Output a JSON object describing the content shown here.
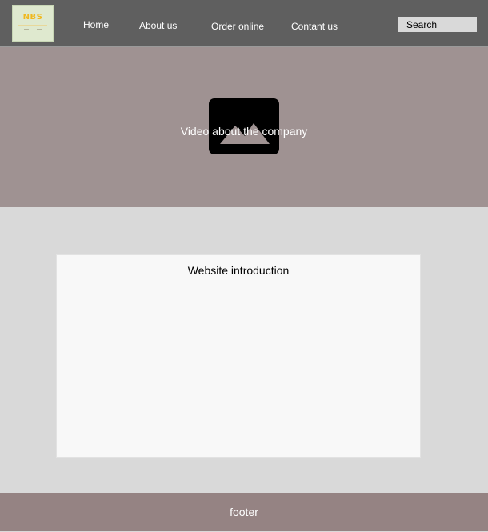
{
  "header": {
    "logo": {
      "text": "NBS"
    },
    "nav": [
      {
        "label": "Home"
      },
      {
        "label": "About us"
      },
      {
        "label": "Order online"
      },
      {
        "label": "Contant us"
      }
    ],
    "search": {
      "placeholder": "Search"
    }
  },
  "hero": {
    "caption": "Video about the company",
    "thumbnail_icon": "image-placeholder-icon"
  },
  "main": {
    "intro_title": "Website introduction"
  },
  "footer": {
    "label": "footer"
  },
  "colors": {
    "header_bg": "#5f5f5f",
    "hero_bg": "#9f9292",
    "content_bg": "#d9d9d9",
    "card_bg": "#f8f8f8",
    "footer_bg": "#958383",
    "logo_accent": "#f0b81e"
  }
}
